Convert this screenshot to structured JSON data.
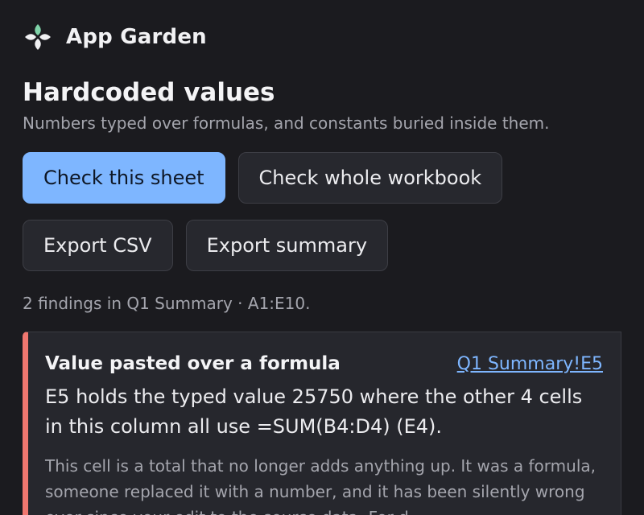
{
  "app": {
    "name": "App Garden",
    "accent_color": "#7fd3a8"
  },
  "page": {
    "title": "Hardcoded values",
    "subtitle": "Numbers typed over formulas, and constants buried inside them."
  },
  "actions": {
    "check_sheet": "Check this sheet",
    "check_workbook": "Check whole workbook",
    "export_csv": "Export CSV",
    "export_summary": "Export summary"
  },
  "status": {
    "text": "2 findings in Q1 Summary · A1:E10."
  },
  "findings": [
    {
      "title": "Value pasted over a formula",
      "location": "Q1 Summary!E5",
      "description": "E5 holds the typed value 25750 where the other 4 cells in this column all use =SUM(B4:D4) (E4).",
      "detail": "This cell is a total that no longer adds anything up. It was a formula, someone replaced it with a number, and it has been silently wrong ever since your edit to the source data. For d",
      "severity_color": "#f0776f"
    }
  ],
  "colors": {
    "background": "#1b1b1f",
    "primary_button": "#7eb6ff",
    "link": "#7eb6ff",
    "finding_marker": "#f0776f"
  }
}
